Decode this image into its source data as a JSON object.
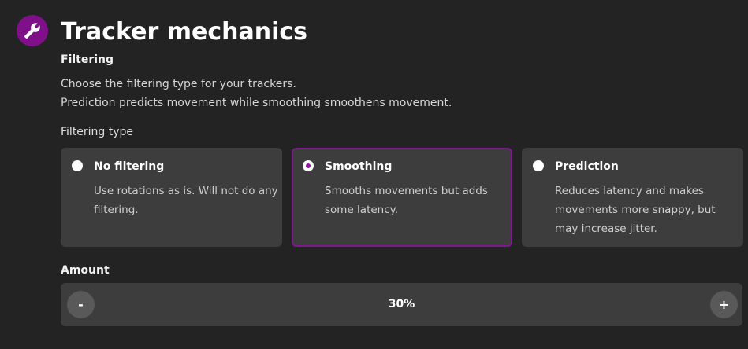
{
  "section": {
    "icon": "wrench-icon",
    "title": "Tracker mechanics",
    "subtitle": "Filtering",
    "description_lines": [
      "Choose the filtering type for your trackers.",
      "Prediction predicts movement while smoothing smoothens movement."
    ],
    "accent_color": "#80108a"
  },
  "filtering": {
    "label": "Filtering type",
    "options": [
      {
        "title": "No filtering",
        "description": "Use rotations as is. Will not do any filtering.",
        "selected": false
      },
      {
        "title": "Smoothing",
        "description": "Smooths movements but adds some latency.",
        "selected": true
      },
      {
        "title": "Prediction",
        "description": "Reduces latency and makes movements more snappy, but may increase jitter.",
        "selected": false
      }
    ]
  },
  "amount": {
    "label": "Amount",
    "value": "30%",
    "decrement_label": "-",
    "increment_label": "+"
  }
}
